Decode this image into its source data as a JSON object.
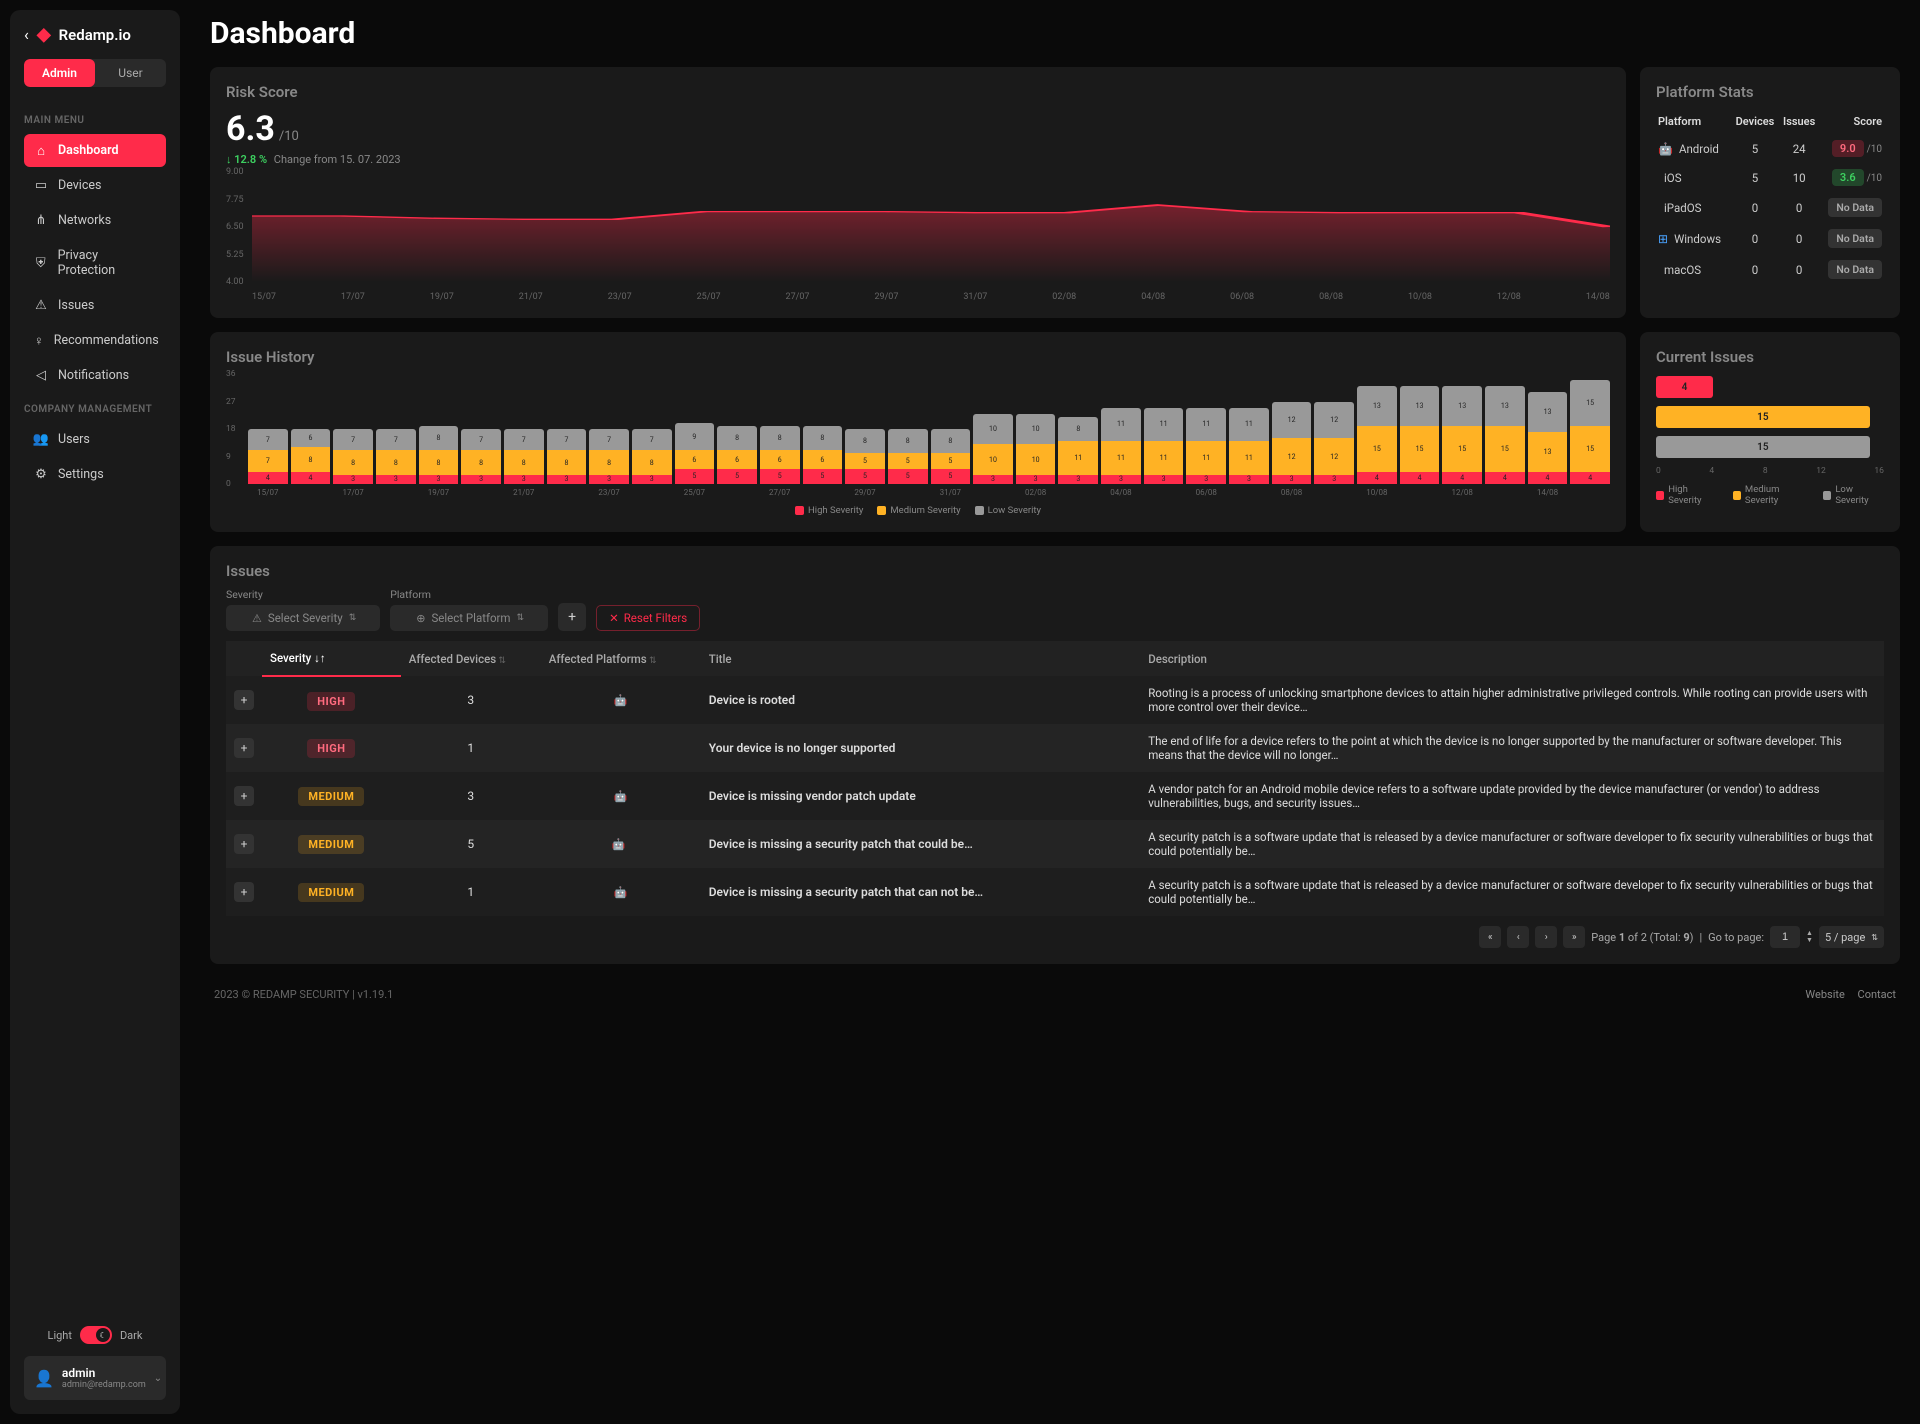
{
  "brand": "Redamp.io",
  "role_tabs": {
    "admin": "Admin",
    "user": "User"
  },
  "section_main": "MAIN MENU",
  "section_company": "COMPANY MANAGEMENT",
  "nav": {
    "dashboard": "Dashboard",
    "devices": "Devices",
    "networks": "Networks",
    "privacy": "Privacy Protection",
    "issues": "Issues",
    "recommendations": "Recommendations",
    "notifications": "Notifications",
    "users": "Users",
    "settings": "Settings"
  },
  "theme": {
    "light": "Light",
    "dark": "Dark"
  },
  "user": {
    "name": "admin",
    "email": "admin@redamp.com"
  },
  "page_title": "Dashboard",
  "risk": {
    "title": "Risk Score",
    "value": "6.3",
    "max": "/10",
    "change_pct": "12.8 %",
    "change_text": "Change from 15. 07. 2023"
  },
  "platform_stats": {
    "title": "Platform Stats",
    "headers": {
      "platform": "Platform",
      "devices": "Devices",
      "issues": "Issues",
      "score": "Score"
    },
    "no_data": "No Data",
    "max_suffix": "/10",
    "rows": [
      {
        "name": "Android",
        "devices": "5",
        "issues": "24",
        "score": "9.0",
        "badge": "red"
      },
      {
        "name": "iOS",
        "devices": "5",
        "issues": "10",
        "score": "3.6",
        "badge": "green"
      },
      {
        "name": "iPadOS",
        "devices": "0",
        "issues": "0",
        "nodata": true
      },
      {
        "name": "Windows",
        "devices": "0",
        "issues": "0",
        "nodata": true
      },
      {
        "name": "macOS",
        "devices": "0",
        "issues": "0",
        "nodata": true
      }
    ]
  },
  "history": {
    "title": "Issue History"
  },
  "current": {
    "title": "Current Issues",
    "values": {
      "high": 4,
      "medium": 15,
      "low": 15
    }
  },
  "legend": {
    "high": "High Severity",
    "medium": "Medium Severity",
    "low": "Low Severity"
  },
  "issues_section": {
    "title": "Issues",
    "filter_severity_label": "Severity",
    "filter_platform_label": "Platform",
    "select_severity": "Select Severity",
    "select_platform": "Select Platform",
    "reset": "Reset Filters",
    "headers": {
      "severity": "Severity",
      "devices": "Affected Devices",
      "platforms": "Affected Platforms",
      "title": "Title",
      "description": "Description"
    },
    "rows": [
      {
        "sev": "HIGH",
        "sev_class": "high",
        "devices": "3",
        "plats": [
          "android"
        ],
        "title": "Device is rooted",
        "desc": "Rooting is a process of unlocking smartphone devices to attain higher administrative privileged controls. While rooting can provide users with more control over their device…"
      },
      {
        "sev": "HIGH",
        "sev_class": "high",
        "devices": "1",
        "plats": [
          "apple"
        ],
        "title": "Your device is no longer supported",
        "desc": "The end of life for a device refers to the point at which the device is no longer supported by the manufacturer or software developer. This means that the device will no longer…"
      },
      {
        "sev": "MEDIUM",
        "sev_class": "medium",
        "devices": "3",
        "plats": [
          "android"
        ],
        "title": "Device is missing vendor patch update",
        "desc": "A vendor patch for an Android mobile device refers to a software update provided by the device manufacturer (or vendor) to address vulnerabilities, bugs, and security issues…"
      },
      {
        "sev": "MEDIUM",
        "sev_class": "medium",
        "devices": "5",
        "plats": [
          "android",
          "apple"
        ],
        "title": "Device is missing a security patch that could be…",
        "desc": "A security patch is a software update that is released by a device manufacturer or software developer to fix security vulnerabilities or bugs that could potentially be…"
      },
      {
        "sev": "MEDIUM",
        "sev_class": "medium",
        "devices": "1",
        "plats": [
          "android"
        ],
        "title": "Device is missing a security patch that can not be…",
        "desc": "A security patch is a software update that is released by a device manufacturer or software developer to fix security vulnerabilities or bugs that could potentially be…"
      }
    ]
  },
  "pager": {
    "page_label_prefix": "Page ",
    "page_current": "1",
    "page_label_mid": " of 2 (Total: ",
    "total": "9",
    "page_label_suffix": ")",
    "goto": "Go to page:",
    "goto_value": "1",
    "page_size": "5 / page"
  },
  "footer": {
    "copyright": "2023 © REDAMP SECURITY | v1.19.1",
    "website": "Website",
    "contact": "Contact"
  },
  "chart_data": {
    "risk_line": {
      "type": "line",
      "title": "Risk Score",
      "ylabel": "",
      "ylim": [
        4.0,
        9.0
      ],
      "yticks": [
        4.0,
        5.25,
        6.5,
        7.75,
        9.0
      ],
      "x": [
        "15/07",
        "17/07",
        "19/07",
        "21/07",
        "23/07",
        "25/07",
        "27/07",
        "29/07",
        "31/07",
        "02/08",
        "04/08",
        "06/08",
        "08/08",
        "10/08",
        "12/08",
        "14/08"
      ],
      "values": [
        7.0,
        7.0,
        6.9,
        6.85,
        6.85,
        7.2,
        7.2,
        7.2,
        7.15,
        7.15,
        7.5,
        7.2,
        7.15,
        7.15,
        7.15,
        6.5
      ]
    },
    "issue_history": {
      "type": "bar",
      "title": "Issue History",
      "ylim": [
        0,
        36
      ],
      "yticks": [
        0,
        9,
        18,
        27,
        36
      ],
      "categories": [
        "15/07",
        "16/07",
        "17/07",
        "18/07",
        "19/07",
        "20/07",
        "21/07",
        "22/07",
        "23/07",
        "24/07",
        "25/07",
        "26/07",
        "27/07",
        "28/07",
        "29/07",
        "30/07",
        "31/07",
        "01/08",
        "02/08",
        "03/08",
        "04/08",
        "05/08",
        "06/08",
        "07/08",
        "08/08",
        "09/08",
        "10/08",
        "11/08",
        "12/08",
        "13/08",
        "14/08",
        "15/08"
      ],
      "series": [
        {
          "name": "High Severity",
          "color": "#ff2b4a",
          "values": [
            4,
            4,
            3,
            3,
            3,
            3,
            3,
            3,
            3,
            3,
            5,
            5,
            5,
            5,
            5,
            5,
            5,
            3,
            3,
            3,
            3,
            3,
            3,
            3,
            3,
            3,
            4,
            4,
            4,
            4,
            4,
            4
          ]
        },
        {
          "name": "Medium Severity",
          "color": "#ffb224",
          "values": [
            7,
            8,
            8,
            8,
            8,
            8,
            8,
            8,
            8,
            8,
            6,
            6,
            6,
            6,
            5,
            5,
            5,
            10,
            10,
            11,
            11,
            11,
            11,
            11,
            12,
            12,
            15,
            15,
            15,
            15,
            13,
            15
          ]
        },
        {
          "name": "Low Severity",
          "color": "#999",
          "values": [
            7,
            6,
            7,
            7,
            8,
            7,
            7,
            7,
            7,
            7,
            9,
            8,
            8,
            8,
            8,
            8,
            8,
            10,
            10,
            8,
            11,
            11,
            11,
            11,
            12,
            12,
            13,
            13,
            13,
            13,
            13,
            15
          ]
        }
      ],
      "xtick_labels": [
        "15/07",
        "",
        "17/07",
        "",
        "19/07",
        "",
        "21/07",
        "",
        "23/07",
        "",
        "25/07",
        "",
        "27/07",
        "",
        "29/07",
        "",
        "31/07",
        "",
        "02/08",
        "",
        "04/08",
        "",
        "06/08",
        "",
        "08/08",
        "",
        "10/08",
        "",
        "12/08",
        "",
        "14/08",
        ""
      ]
    },
    "current_issues": {
      "type": "bar",
      "orientation": "horizontal",
      "title": "Current Issues",
      "xlim": [
        0,
        16
      ],
      "xticks": [
        0,
        4,
        8,
        12,
        16
      ],
      "categories": [
        "High Severity",
        "Medium Severity",
        "Low Severity"
      ],
      "values": [
        4,
        15,
        15
      ],
      "colors": [
        "#ff2b4a",
        "#ffb224",
        "#999"
      ]
    }
  }
}
